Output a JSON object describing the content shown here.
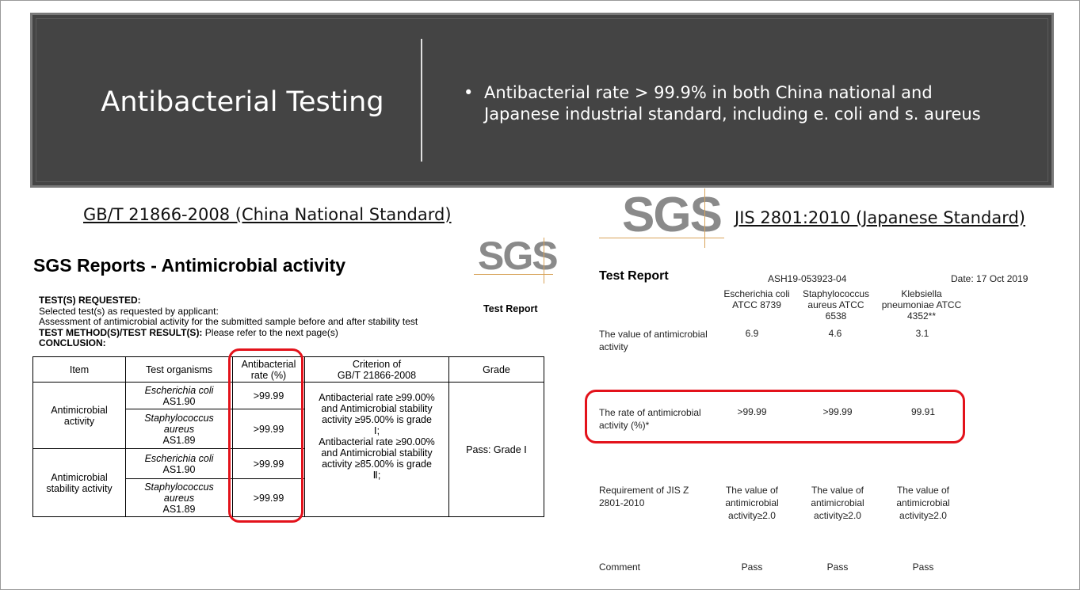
{
  "banner": {
    "title": "Antibacterial Testing",
    "bullet_line1": "Antibacterial rate > 99.9% in both China national and",
    "bullet_line2": "Japanese industrial standard, including e. coli and s. aureus"
  },
  "left": {
    "standard_title": "GB/T 21866-2008 (China National Standard)",
    "logo_text": "SGS",
    "report_heading": "SGS Reports - Antimicrobial activity",
    "tests_requested_label": "TEST(S) REQUESTED:",
    "line_selected": "Selected test(s) as requested by applicant:",
    "line_assessment": "Assessment of antimicrobial activity for the submitted sample before and after stability test",
    "method_label": "TEST METHOD(S)/TEST RESULT(S):",
    "method_text": " Please refer to the next page(s)",
    "conclusion_label": "CONCLUSION:",
    "test_report_label": "Test Report",
    "table": {
      "headers": {
        "item": "Item",
        "organisms": "Test organisms",
        "rate_l1": "Antibacterial",
        "rate_l2": "rate (%)",
        "criterion_l1": "Criterion of",
        "criterion_l2": "GB/T 21866-2008",
        "grade": "Grade"
      },
      "item1_l1": "Antimicrobial",
      "item1_l2": "activity",
      "item2_l1": "Antimicrobial",
      "item2_l2": "stability activity",
      "org_ecoli": "Escherichia coli",
      "org_ecoli_code": "AS1.90",
      "org_staph_l1": "Staphylococcus",
      "org_staph_l2": "aureus",
      "org_staph_code": "AS1.89",
      "rate1": ">99.99",
      "rate2": ">99.99",
      "rate3": ">99.99",
      "rate4": ">99.99",
      "criterion": {
        "l1": "Antibacterial rate ≥99.00%",
        "l2": "and Antimicrobial stability",
        "l3": "activity ≥95.00% is grade",
        "l4": "Ⅰ;",
        "l5": "Antibacterial rate ≥90.00%",
        "l6": "and Antimicrobial stability",
        "l7": "activity ≥85.00% is grade",
        "l8": "Ⅱ;"
      },
      "grade": "Pass: Grade Ⅰ"
    }
  },
  "right": {
    "standard_title": "JIS 2801:2010 (Japanese Standard)",
    "logo_text": "SGS",
    "test_report": "Test Report",
    "report_no": "ASH19-053923-04",
    "date": "Date: 17 Oct 2019",
    "col1_l1": "Escherichia coli",
    "col1_l2": "ATCC 8739",
    "col2_l1": "Staphylococcus",
    "col2_l2": "aureus  ATCC",
    "col2_l3": "6538",
    "col3_l1": "Klebsiella",
    "col3_l2": "pneumoniae ATCC",
    "col3_l3": "4352**",
    "value_label_l1": "The value of antimicrobial",
    "value_label_l2": "activity",
    "value1": "6.9",
    "value2": "4.6",
    "value3": "3.1",
    "rate_label_l1": "The rate of antimicrobial",
    "rate_label_l2": "activity (%)*",
    "rate1": ">99.99",
    "rate2": ">99.99",
    "rate3": "99.91",
    "req_label_l1": "Requirement of JIS Z",
    "req_label_l2": "2801-2010",
    "req_l1": "The value of",
    "req_l2": "antimicrobial",
    "req_l3": "activity≥2.0",
    "comment_label": "Comment",
    "comment1": "Pass",
    "comment2": "Pass",
    "comment3": "Pass"
  }
}
